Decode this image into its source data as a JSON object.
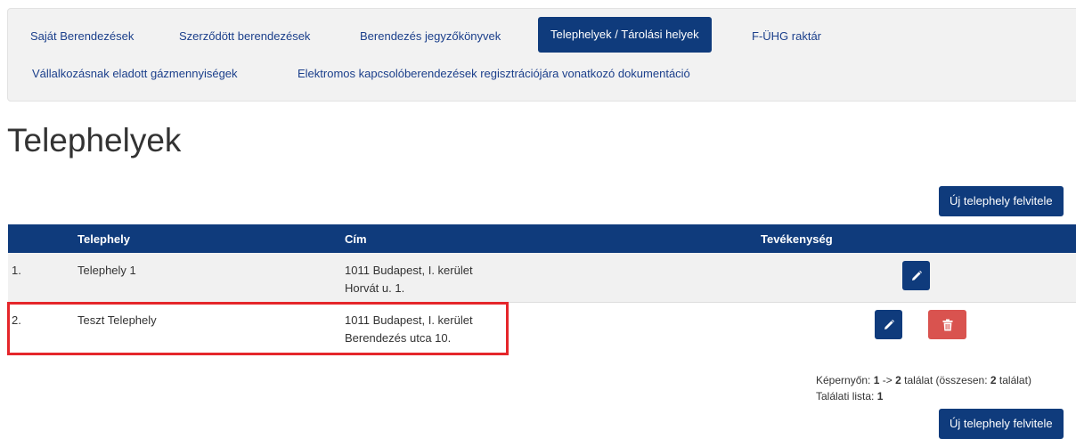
{
  "nav": {
    "tabs": [
      {
        "label": "Saját Berendezések"
      },
      {
        "label": "Szerződött berendezések"
      },
      {
        "label": "Berendezés jegyzőkönyvek"
      },
      {
        "label": "Telephelyek / Tárolási helyek"
      },
      {
        "label": "F-ÜHG raktár"
      },
      {
        "label": "Vállalkozásnak eladott gázmennyiségek"
      },
      {
        "label": "Elektromos kapcsolóberendezések regisztrációjára vonatkozó dokumentáció"
      }
    ],
    "active_tab": "Telephelyek / Tárolási helyek"
  },
  "page": {
    "title": "Telephelyek",
    "add_button_label": "Új telephely felvitele"
  },
  "table": {
    "columns": [
      "Telephely",
      "Cím",
      "Tevékenység"
    ],
    "rows": [
      {
        "num": "1.",
        "telephely": "Telephely 1",
        "cim_line1": "1011 Budapest, I. kerület",
        "cim_line2": "Horvát u. 1."
      },
      {
        "num": "2.",
        "telephely": "Teszt Telephely",
        "cim_line1": "1011 Budapest, I. kerület",
        "cim_line2": "Berendezés utca 10."
      }
    ]
  },
  "pager": {
    "label_screen": "Képernyőn:",
    "from": "1",
    "arrow": "->",
    "to": "2",
    "label_results": "találat (összesen:",
    "total": "2",
    "label_total_suffix": "találat)",
    "list_label": "Találati lista:",
    "list_page": "1"
  },
  "colors": {
    "primary": "#0f3b7c",
    "danger": "#d9534f",
    "highlight": "#e5262b"
  },
  "icons": {
    "edit": "pencil-icon",
    "delete": "trash-icon"
  }
}
